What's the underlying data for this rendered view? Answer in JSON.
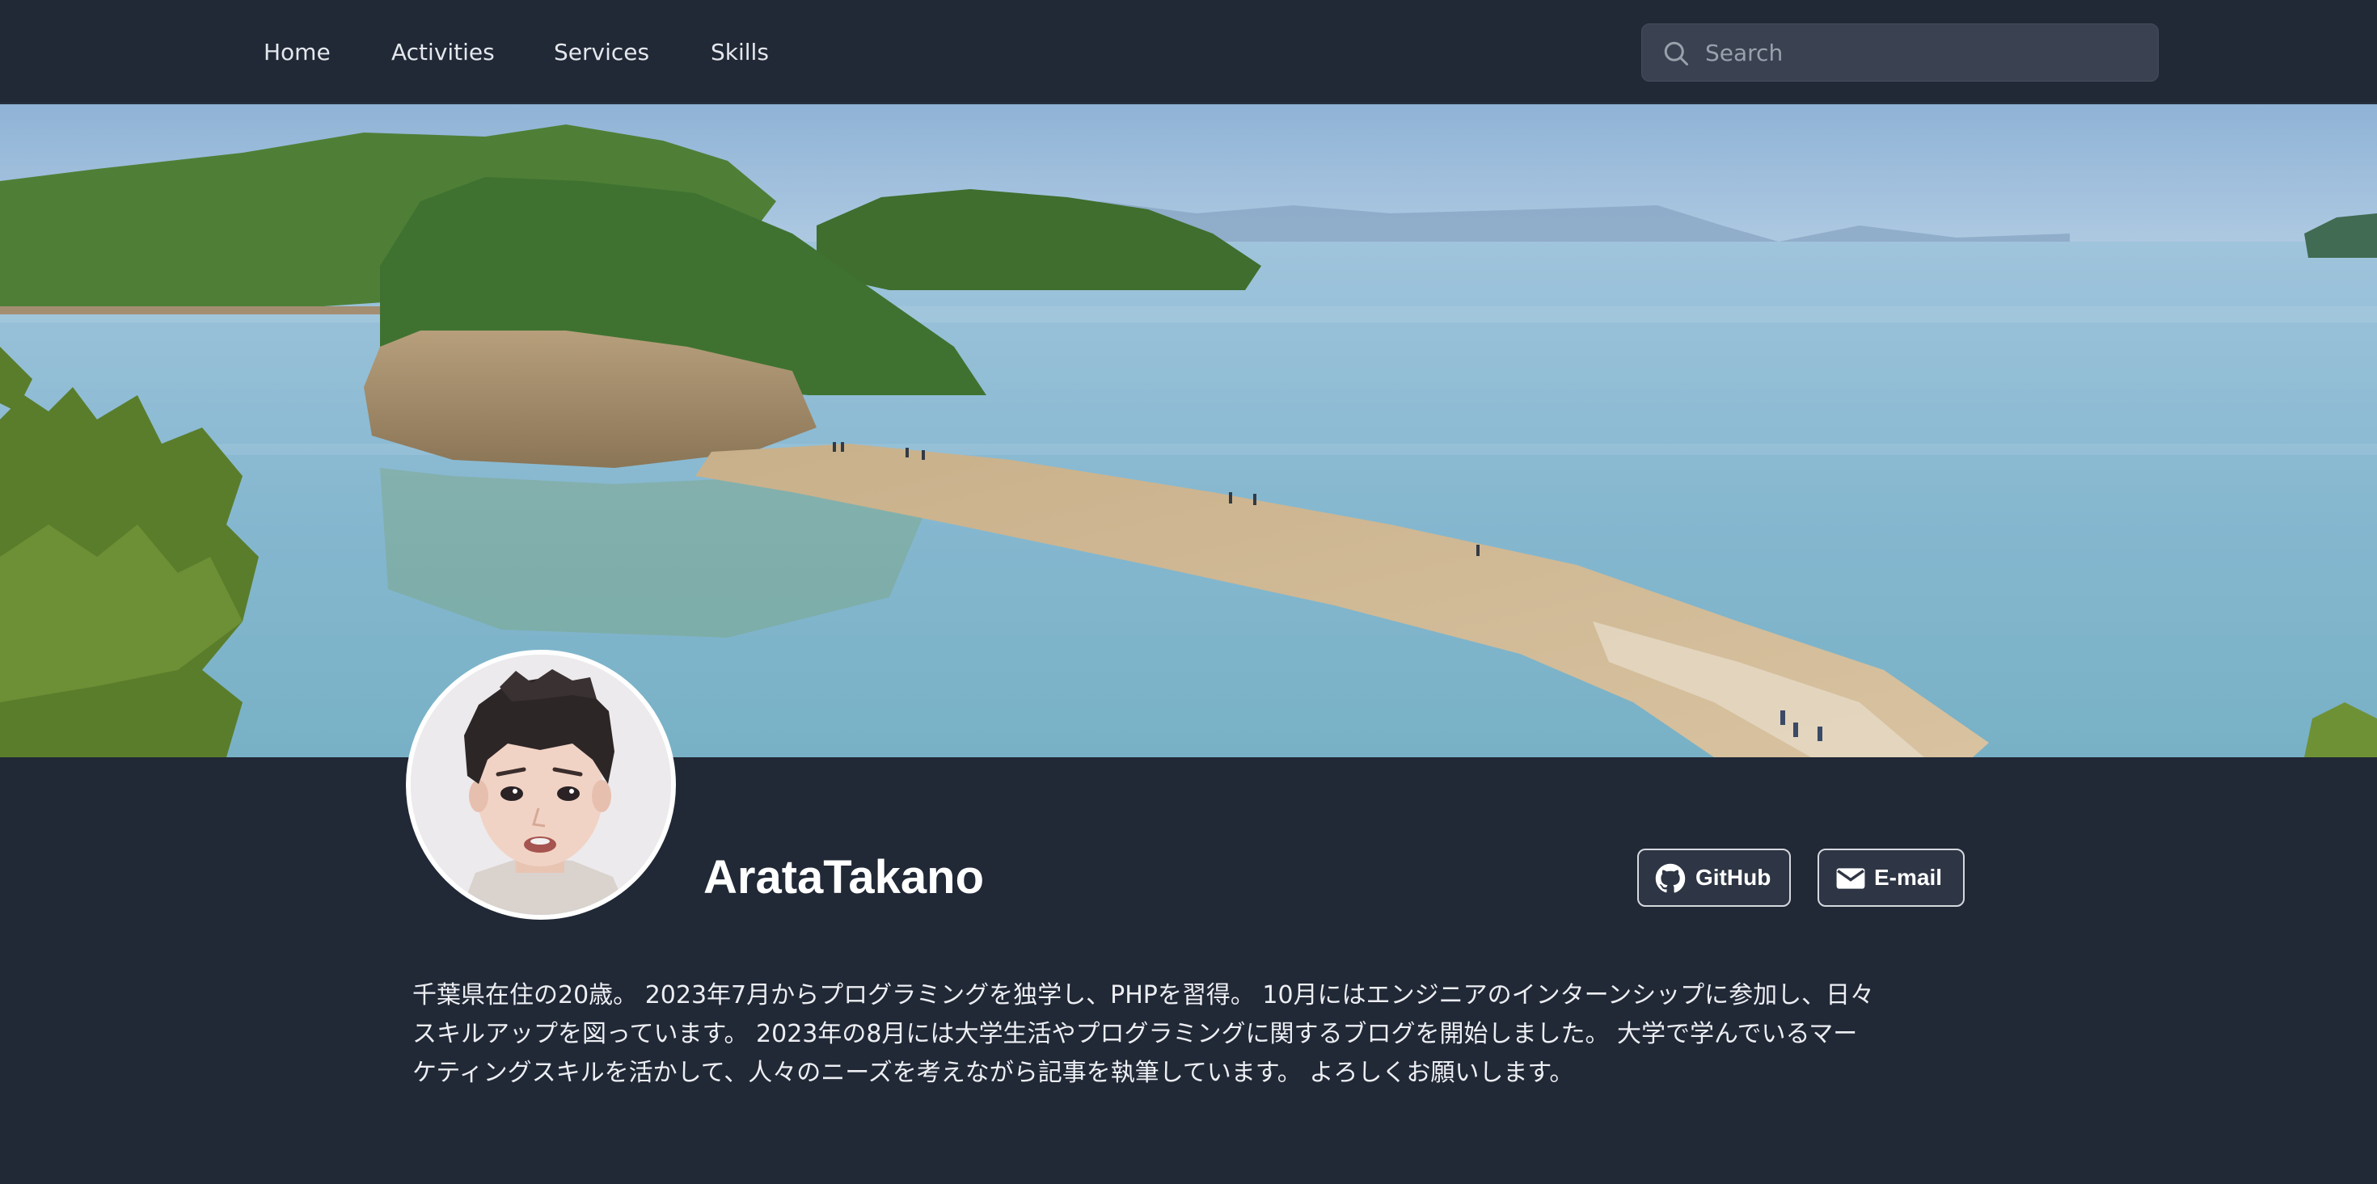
{
  "nav": {
    "items": [
      {
        "label": "Home"
      },
      {
        "label": "Activities"
      },
      {
        "label": "Services"
      },
      {
        "label": "Skills"
      }
    ],
    "search": {
      "placeholder": "Search",
      "value": "",
      "icon": "search-icon"
    }
  },
  "profile": {
    "name": "ArataTakano",
    "buttons": {
      "github": {
        "label": "GitHub",
        "icon": "github-icon"
      },
      "email": {
        "label": "E-mail",
        "icon": "mail-icon"
      }
    },
    "bio": "千葉県在住の20歳。 2023年7月からプログラミングを独学し、PHPを習得。 10月にはエンジニアのインターンシップに参加し、日々\nスキルアップを図っています。 2023年の8月には大学生活やプログラミングに関するブログを開始しました。 大学で学んでいるマー\nケティングスキルを活かして、人々のニーズを考えながら記事を執筆しています。 よろしくお願いします。"
  },
  "colors": {
    "background": "#212836",
    "nav_text": "#e4e7ec",
    "search_bg": "#3a4150",
    "button_border": "#d5d8de"
  }
}
